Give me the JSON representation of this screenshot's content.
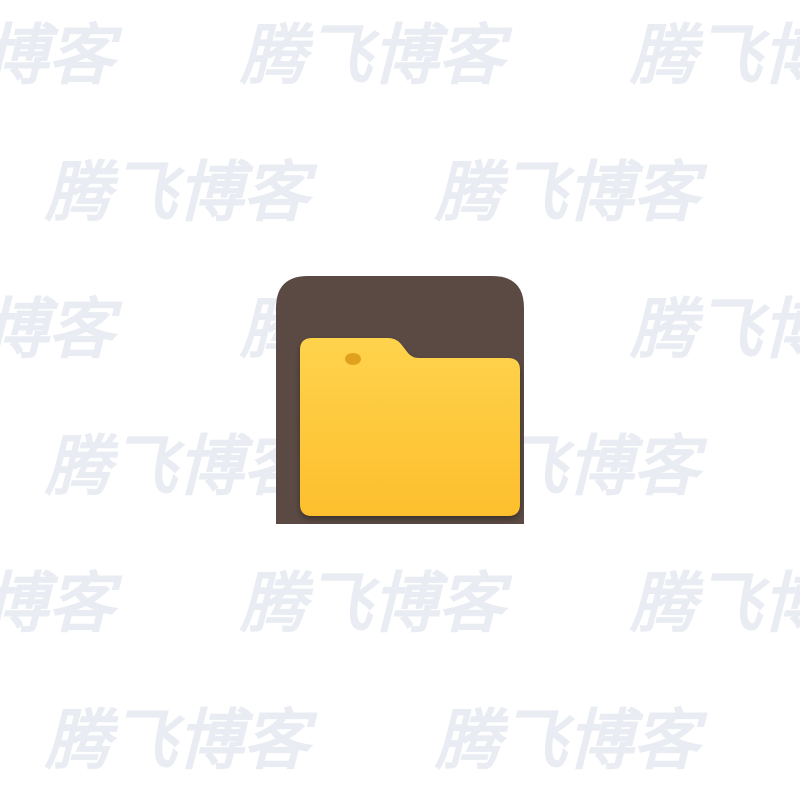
{
  "watermark": {
    "text": "腾飞博客",
    "color": "#e9ecf2"
  },
  "app_icon": {
    "icon": "folder-icon",
    "tile_color": "#5a4a43",
    "folder_color": "#fdbf2d",
    "folder_highlight": "#ffd34d",
    "folder_shadow": "#e0a21c"
  }
}
